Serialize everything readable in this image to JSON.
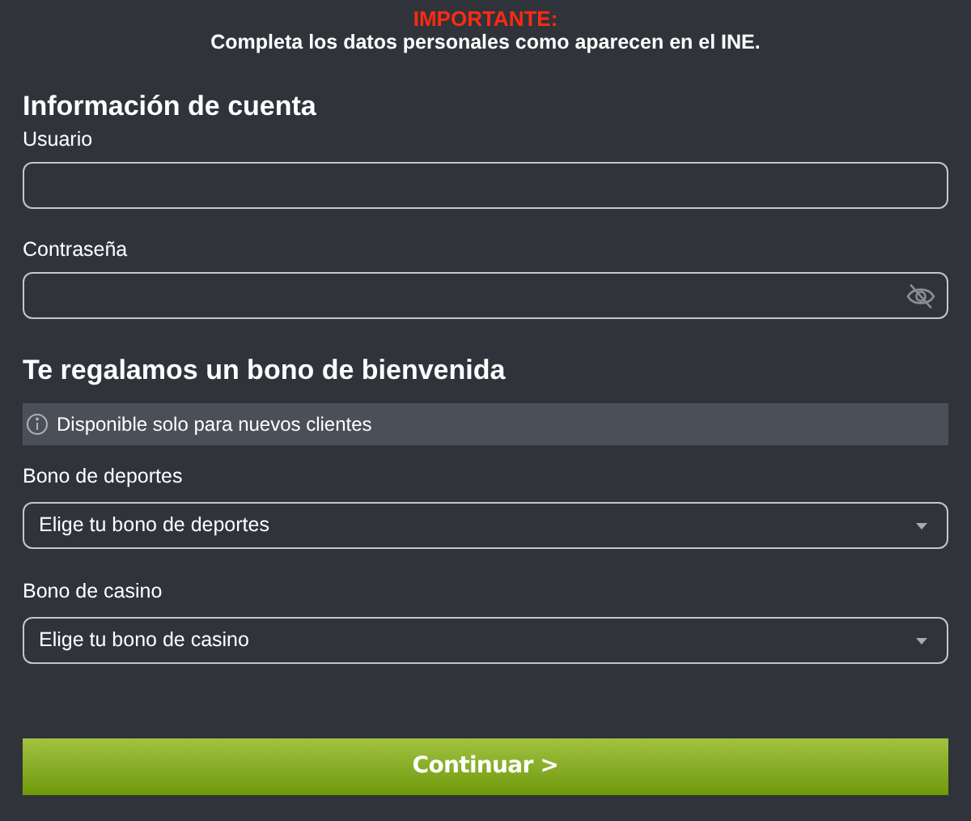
{
  "notice": {
    "title": "IMPORTANTE:",
    "text": "Completa los datos personales como aparecen en el INE."
  },
  "account": {
    "heading": "Información de cuenta",
    "fields": [
      {
        "label": "Usuario",
        "kind": "text"
      },
      {
        "label": "Contraseña",
        "kind": "password"
      }
    ]
  },
  "bonus": {
    "heading": "Te regalamos un bono de bienvenida",
    "info": "Disponible solo para nuevos clientes",
    "selects": [
      {
        "label": "Bono de deportes",
        "value": "Elige tu bono de deportes"
      },
      {
        "label": "Bono de casino",
        "value": "Elige tu bono de casino"
      }
    ]
  },
  "submit": "Continuar >"
}
